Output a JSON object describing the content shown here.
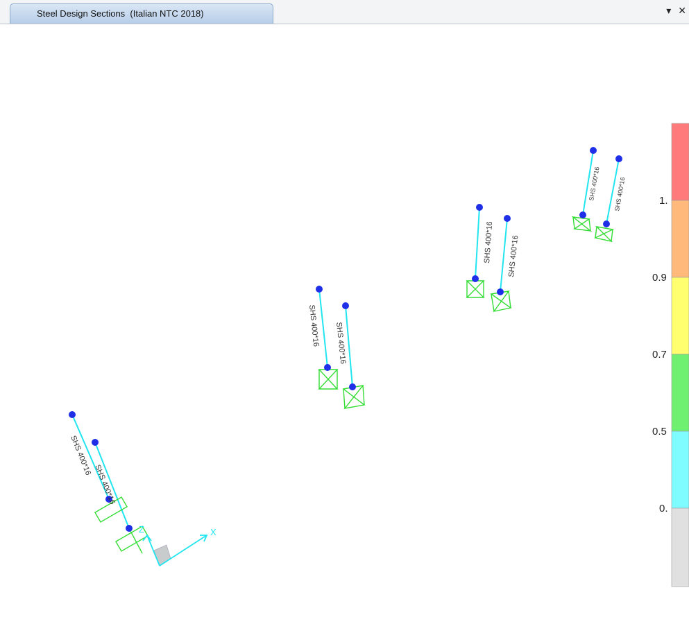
{
  "window": {
    "tab_title": "Steel Design Sections  (Italian NTC 2018)",
    "dropdown_icon": "chevron-down-icon",
    "close_icon": "close-icon"
  },
  "model": {
    "section_label": "SHS 400*16",
    "axis_x_label": "X",
    "axis_z_label": "Z",
    "member_color": "#22e5ef",
    "joint_color": "#1f2fe8",
    "support_color": "#33dd33"
  },
  "legend": {
    "ticks": [
      "1.",
      "0.9",
      "0.7",
      "0.5",
      "0."
    ],
    "bands": [
      {
        "color": "#ff7b7b"
      },
      {
        "color": "#ffb97a"
      },
      {
        "color": "#ffff70"
      },
      {
        "color": "#70f070"
      },
      {
        "color": "#7ffcff"
      },
      {
        "color": "#e0e0e0"
      }
    ]
  }
}
